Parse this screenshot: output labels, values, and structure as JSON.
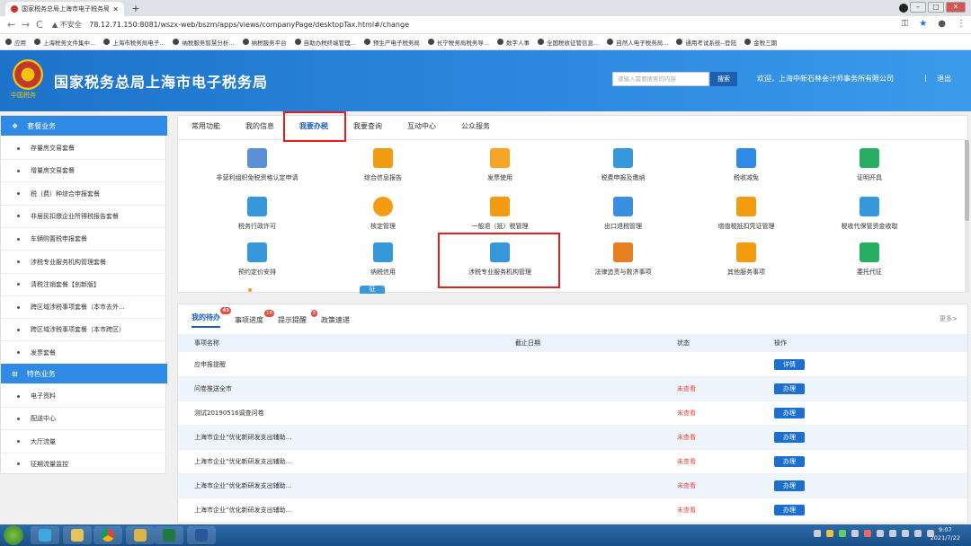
{
  "browser": {
    "tab_title": "国家税务总局上海市电子税务局",
    "new_tab": "+",
    "address_warning": "▲ 不安全",
    "url": "78.12.71.150:8081/wszx-web/bszm/apps/views/companyPage/desktopTax.html#/change",
    "nav_back": "←",
    "nav_forward": "→",
    "nav_reload": "C",
    "bookmarks": [
      "应用",
      "上海税务文件集中...",
      "上海市税务局电子...",
      "纳税服务智慧分析...",
      "纳税服务平台",
      "自助办税终端管理...",
      "预生产电子税务局",
      "长宁税务局税务导...",
      "数字人事",
      "全国税收征管信息...",
      "自然人电子税务局...",
      "通用考试系统--登陆",
      "金税三期"
    ]
  },
  "header": {
    "emblem_text": "中国税务",
    "title": "国家税务总局上海市电子税务局",
    "search_placeholder": "请输入需要搜索的内容",
    "search_button": "搜索",
    "welcome": "欢迎，上海中新石林会计师事务所有限公司",
    "separator": "|",
    "logout": "退出"
  },
  "sidebar": {
    "section1": "套餐业务",
    "items1": [
      "存量房交易套餐",
      "增量房交易套餐",
      "税（费）种综合申报套餐",
      "非居民扣缴企业所得税报告套餐",
      "车辆购置税申报套餐",
      "涉税专业服务机构管理套餐",
      "清税注销套餐【创新版】",
      "跨区域涉税事项套餐（本市去外...",
      "跨区域涉税事项套餐（本市跨区）",
      "发票套餐"
    ],
    "section2": "特色业务",
    "items2": [
      "电子资料",
      "配送中心",
      "大厅流量",
      "征期流量监控"
    ]
  },
  "tabs": [
    "常用功能",
    "我的信息",
    "我要办税",
    "我要查询",
    "互动中心",
    "公众服务"
  ],
  "active_tab": "我要办税",
  "grid": [
    "非营利组织免税资格认定申请",
    "综合信息报告",
    "发票使用",
    "税费申报及缴纳",
    "税收减免",
    "证明开具",
    "税务行政许可",
    "核定管理",
    "一般退（抵）税管理",
    "出口退税管理",
    "增值税抵扣凭证管理",
    "税收代保管资金收取",
    "预约定价安排",
    "纳税信用",
    "涉税专业服务机构管理",
    "法律追责与救济事项",
    "其他服务事项",
    "委托代征"
  ],
  "grid_icon_labels": {
    "tax_relief": "税",
    "refund": "退",
    "export": "税",
    "credit": "信",
    "partial": "征"
  },
  "lower_tabs": [
    {
      "label": "我的待办",
      "badge": "43"
    },
    {
      "label": "事项进度",
      "badge": "18"
    },
    {
      "label": "提示提醒",
      "badge": "3"
    },
    {
      "label": "政策速递",
      "badge": ""
    }
  ],
  "more": "更多>",
  "table": {
    "headers": [
      "事项名称",
      "截止日期",
      "状态",
      "操作"
    ],
    "rows": [
      {
        "name": "应申报提醒",
        "date": "",
        "status": "",
        "action": "详情"
      },
      {
        "name": "问卷推送全市",
        "date": "",
        "status": "未查看",
        "action": "办理"
      },
      {
        "name": "测试20190516调查问卷",
        "date": "",
        "status": "未查看",
        "action": "办理"
      },
      {
        "name": "上海市企业“优化新研发支出辅助...",
        "date": "",
        "status": "未查看",
        "action": "办理"
      },
      {
        "name": "上海市企业“优化新研发支出辅助...",
        "date": "",
        "status": "未查看",
        "action": "办理"
      },
      {
        "name": "上海市企业“优化新研发支出辅助...",
        "date": "",
        "status": "未查看",
        "action": "办理"
      },
      {
        "name": "上海市企业“优化新研发支出辅助...",
        "date": "",
        "status": "未查看",
        "action": "办理"
      }
    ]
  },
  "taskbar": {
    "time": "9:07",
    "date": "2021/7/22"
  },
  "colors": {
    "brand_blue": "#2f8ae5",
    "header_blue": "#1d73c9",
    "highlight_red": "#e02020",
    "status_red": "#e74c3c"
  }
}
